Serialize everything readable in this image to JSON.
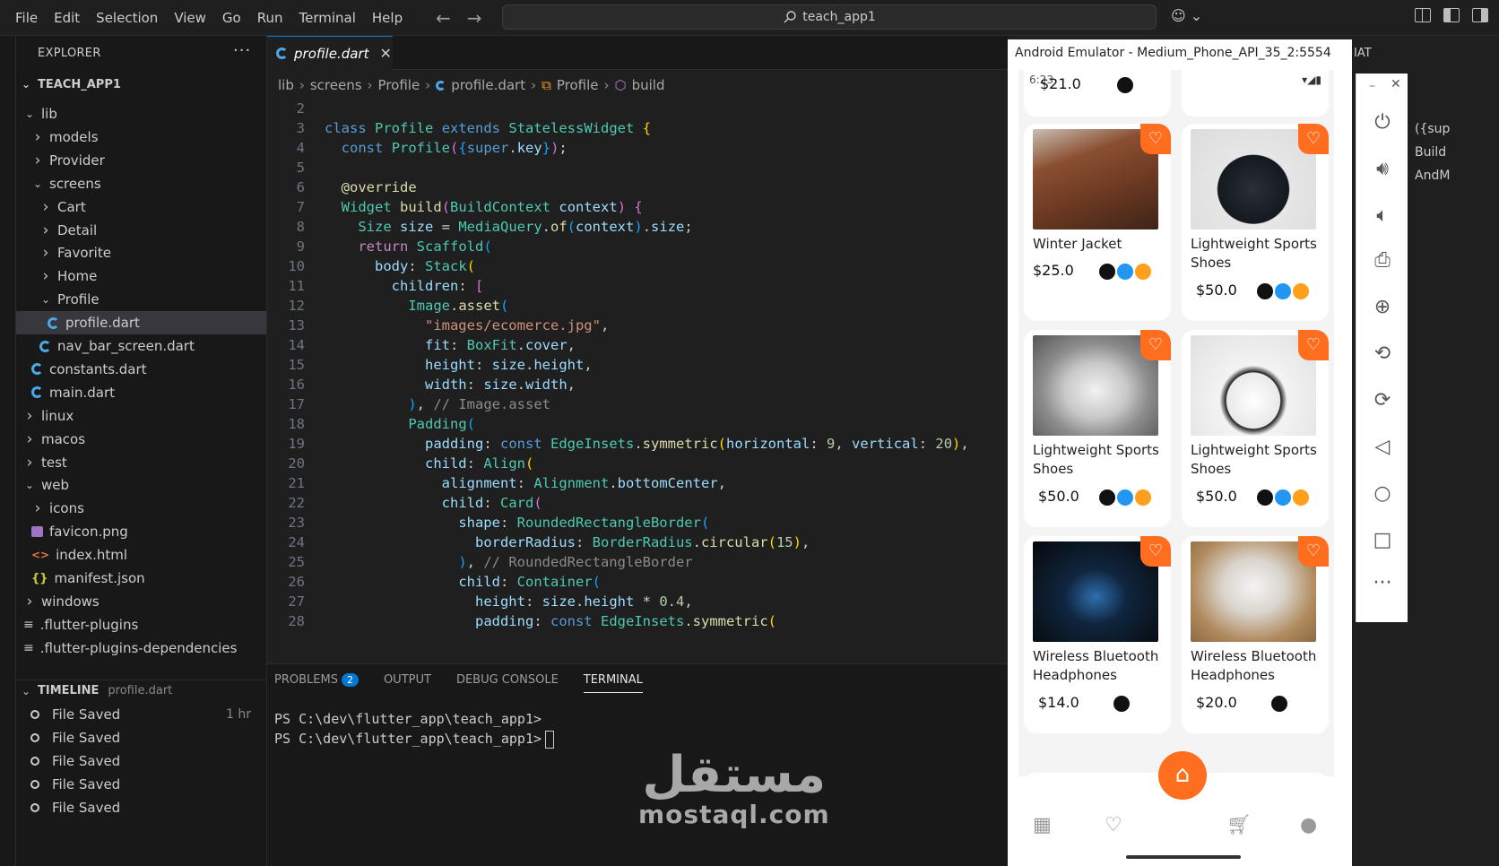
{
  "titlebar": {
    "menus": [
      "File",
      "Edit",
      "Selection",
      "View",
      "Go",
      "Run",
      "Terminal",
      "Help"
    ],
    "search_text": "teach_app1"
  },
  "explorer": {
    "heading": "EXPLORER",
    "more": "···",
    "workspace": "TEACH_APP1",
    "items": [
      {
        "label": "lib",
        "type": "folder-open",
        "indent": 1
      },
      {
        "label": "models",
        "type": "folder",
        "indent": 2
      },
      {
        "label": "Provider",
        "type": "folder",
        "indent": 2
      },
      {
        "label": "screens",
        "type": "folder-open",
        "indent": 2
      },
      {
        "label": "Cart",
        "type": "folder",
        "indent": 3
      },
      {
        "label": "Detail",
        "type": "folder",
        "indent": 3
      },
      {
        "label": "Favorite",
        "type": "folder",
        "indent": 3
      },
      {
        "label": "Home",
        "type": "folder",
        "indent": 3
      },
      {
        "label": "Profile",
        "type": "folder-open",
        "indent": 3
      },
      {
        "label": "profile.dart",
        "type": "dart",
        "indent": 4,
        "selected": true
      },
      {
        "label": "nav_bar_screen.dart",
        "type": "dart",
        "indent": 3
      },
      {
        "label": "constants.dart",
        "type": "dart",
        "indent": 2
      },
      {
        "label": "main.dart",
        "type": "dart",
        "indent": 2
      },
      {
        "label": "linux",
        "type": "folder",
        "indent": 1
      },
      {
        "label": "macos",
        "type": "folder",
        "indent": 1
      },
      {
        "label": "test",
        "type": "folder",
        "indent": 1
      },
      {
        "label": "web",
        "type": "folder-open",
        "indent": 1
      },
      {
        "label": "icons",
        "type": "folder",
        "indent": 2
      },
      {
        "label": "favicon.png",
        "type": "image",
        "indent": 2
      },
      {
        "label": "index.html",
        "type": "html",
        "indent": 2
      },
      {
        "label": "manifest.json",
        "type": "json",
        "indent": 2
      },
      {
        "label": "windows",
        "type": "folder",
        "indent": 1
      },
      {
        "label": ".flutter-plugins",
        "type": "text",
        "indent": 1
      },
      {
        "label": ".flutter-plugins-dependencies",
        "type": "text",
        "indent": 1
      }
    ]
  },
  "timeline": {
    "heading": "TIMELINE",
    "file": "profile.dart",
    "entries": [
      {
        "label": "File Saved",
        "time": "1 hr"
      },
      {
        "label": "File Saved",
        "time": ""
      },
      {
        "label": "File Saved",
        "time": ""
      },
      {
        "label": "File Saved",
        "time": ""
      },
      {
        "label": "File Saved",
        "time": ""
      }
    ]
  },
  "editor": {
    "tab": "profile.dart",
    "breadcrumbs": [
      "lib",
      "screens",
      "Profile",
      "profile.dart",
      "Profile",
      "build"
    ]
  },
  "panel": {
    "tabs": [
      "PROBLEMS",
      "OUTPUT",
      "DEBUG CONSOLE",
      "TERMINAL"
    ],
    "problems_count": "2",
    "terminal_lines": [
      "PS C:\\dev\\flutter_app\\teach_app1>",
      "PS C:\\dev\\flutter_app\\teach_app1>"
    ]
  },
  "watermark": {
    "arabic": "مستقل",
    "latin": "mostaql.com"
  },
  "right_fragment": {
    "tab": "IAT",
    "lines": [
      "({sup",
      "Build",
      "AndM"
    ]
  },
  "emulator": {
    "title": "Android Emulator - Medium_Phone_API_35_2:5554",
    "status_time": "6:23",
    "top_partial_price": "$21.0",
    "products": [
      {
        "name": "Winter Jacket",
        "price": "$25.0",
        "colors": [
          "#111111",
          "#2196f3",
          "#ff9f1c"
        ],
        "photo": "jacket"
      },
      {
        "name": "Lightweight Sports Shoes",
        "price": "$50.0",
        "colors": [
          "#111111",
          "#2196f3",
          "#ff9f1c"
        ],
        "photo": "shoe-black"
      },
      {
        "name": "Lightweight Sports Shoes",
        "price": "$50.0",
        "colors": [
          "#111111",
          "#2196f3",
          "#ff9f1c"
        ],
        "photo": "shoe-grey"
      },
      {
        "name": "Lightweight Sports Shoes",
        "price": "$50.0",
        "colors": [
          "#111111",
          "#2196f3",
          "#ff9f1c"
        ],
        "photo": "shoe-white"
      },
      {
        "name": "Wireless Bluetooth Headphones",
        "price": "$14.0",
        "colors": [
          "#111111",
          "#ffffff"
        ],
        "photo": "earbuds"
      },
      {
        "name": "Wireless Bluetooth Headphones",
        "price": "$20.0",
        "colors": [
          "#111111",
          "#ffffff"
        ],
        "photo": "headphones"
      }
    ],
    "accent": "#ff6d1f"
  }
}
